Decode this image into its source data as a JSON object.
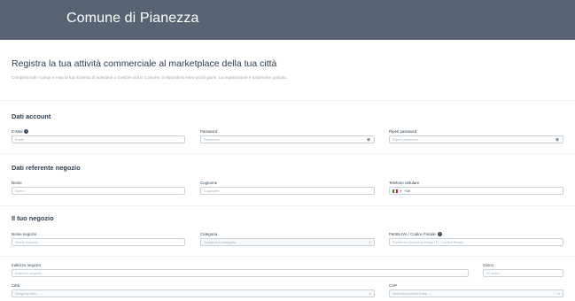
{
  "header": {
    "brand": "Comune di Pianezza"
  },
  "intro": {
    "title": "Registra la tua attività commerciale al marketplace della tua città",
    "subtitle": "Completa tutti i campi e invia la tua richiesta di adesione a Gestore al tuo Comune, ti risponderà entro pochi giorni. La registrazione è totalmente gratuita."
  },
  "sections": {
    "account": "Dati account",
    "referent": "Dati referente negozio",
    "shop": "Il tuo negozio"
  },
  "fields": {
    "email": {
      "label": "E-Mail",
      "placeholder": "Email"
    },
    "password": {
      "label": "Password",
      "placeholder": "Password"
    },
    "password_repeat": {
      "label": "Ripeti password",
      "placeholder": "Ripeti password"
    },
    "first_name": {
      "label": "Nome",
      "placeholder": "Nome"
    },
    "last_name": {
      "label": "Cognome",
      "placeholder": "Cognome"
    },
    "phone": {
      "label": "Telefono cellulare",
      "prefix": "+39"
    },
    "shop_name": {
      "label": "Nome negozio",
      "placeholder": "Nome negozio"
    },
    "category": {
      "label": "Categoria",
      "placeholder": "Scegli una categoria"
    },
    "vat": {
      "label": "Partita IVA / Codice Fiscale",
      "placeholder": "Partita iva (senza prefisso IT) / Codice fiscale"
    },
    "address": {
      "label": "Indirizzo negozio",
      "placeholder": "Indirizzo negozio"
    },
    "civic": {
      "label": "Civico",
      "placeholder": "Nº civico"
    },
    "city": {
      "label": "Città",
      "placeholder": "Scegli la città"
    },
    "cap": {
      "label": "CAP",
      "placeholder": "Seleziona prima il cap"
    }
  },
  "icons": {
    "info": "info-icon",
    "eye": "eye-icon",
    "chevron": "chevron-down-icon",
    "flag": "italy-flag-icon"
  }
}
